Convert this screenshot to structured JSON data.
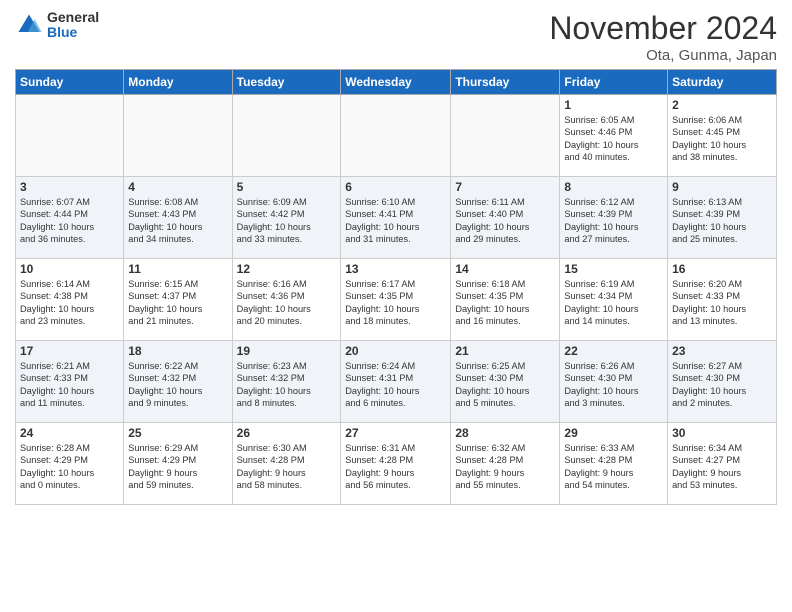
{
  "logo": {
    "general": "General",
    "blue": "Blue"
  },
  "title": "November 2024",
  "location": "Ota, Gunma, Japan",
  "days_of_week": [
    "Sunday",
    "Monday",
    "Tuesday",
    "Wednesday",
    "Thursday",
    "Friday",
    "Saturday"
  ],
  "weeks": [
    [
      {
        "day": "",
        "info": ""
      },
      {
        "day": "",
        "info": ""
      },
      {
        "day": "",
        "info": ""
      },
      {
        "day": "",
        "info": ""
      },
      {
        "day": "",
        "info": ""
      },
      {
        "day": "1",
        "info": "Sunrise: 6:05 AM\nSunset: 4:46 PM\nDaylight: 10 hours\nand 40 minutes."
      },
      {
        "day": "2",
        "info": "Sunrise: 6:06 AM\nSunset: 4:45 PM\nDaylight: 10 hours\nand 38 minutes."
      }
    ],
    [
      {
        "day": "3",
        "info": "Sunrise: 6:07 AM\nSunset: 4:44 PM\nDaylight: 10 hours\nand 36 minutes."
      },
      {
        "day": "4",
        "info": "Sunrise: 6:08 AM\nSunset: 4:43 PM\nDaylight: 10 hours\nand 34 minutes."
      },
      {
        "day": "5",
        "info": "Sunrise: 6:09 AM\nSunset: 4:42 PM\nDaylight: 10 hours\nand 33 minutes."
      },
      {
        "day": "6",
        "info": "Sunrise: 6:10 AM\nSunset: 4:41 PM\nDaylight: 10 hours\nand 31 minutes."
      },
      {
        "day": "7",
        "info": "Sunrise: 6:11 AM\nSunset: 4:40 PM\nDaylight: 10 hours\nand 29 minutes."
      },
      {
        "day": "8",
        "info": "Sunrise: 6:12 AM\nSunset: 4:39 PM\nDaylight: 10 hours\nand 27 minutes."
      },
      {
        "day": "9",
        "info": "Sunrise: 6:13 AM\nSunset: 4:39 PM\nDaylight: 10 hours\nand 25 minutes."
      }
    ],
    [
      {
        "day": "10",
        "info": "Sunrise: 6:14 AM\nSunset: 4:38 PM\nDaylight: 10 hours\nand 23 minutes."
      },
      {
        "day": "11",
        "info": "Sunrise: 6:15 AM\nSunset: 4:37 PM\nDaylight: 10 hours\nand 21 minutes."
      },
      {
        "day": "12",
        "info": "Sunrise: 6:16 AM\nSunset: 4:36 PM\nDaylight: 10 hours\nand 20 minutes."
      },
      {
        "day": "13",
        "info": "Sunrise: 6:17 AM\nSunset: 4:35 PM\nDaylight: 10 hours\nand 18 minutes."
      },
      {
        "day": "14",
        "info": "Sunrise: 6:18 AM\nSunset: 4:35 PM\nDaylight: 10 hours\nand 16 minutes."
      },
      {
        "day": "15",
        "info": "Sunrise: 6:19 AM\nSunset: 4:34 PM\nDaylight: 10 hours\nand 14 minutes."
      },
      {
        "day": "16",
        "info": "Sunrise: 6:20 AM\nSunset: 4:33 PM\nDaylight: 10 hours\nand 13 minutes."
      }
    ],
    [
      {
        "day": "17",
        "info": "Sunrise: 6:21 AM\nSunset: 4:33 PM\nDaylight: 10 hours\nand 11 minutes."
      },
      {
        "day": "18",
        "info": "Sunrise: 6:22 AM\nSunset: 4:32 PM\nDaylight: 10 hours\nand 9 minutes."
      },
      {
        "day": "19",
        "info": "Sunrise: 6:23 AM\nSunset: 4:32 PM\nDaylight: 10 hours\nand 8 minutes."
      },
      {
        "day": "20",
        "info": "Sunrise: 6:24 AM\nSunset: 4:31 PM\nDaylight: 10 hours\nand 6 minutes."
      },
      {
        "day": "21",
        "info": "Sunrise: 6:25 AM\nSunset: 4:30 PM\nDaylight: 10 hours\nand 5 minutes."
      },
      {
        "day": "22",
        "info": "Sunrise: 6:26 AM\nSunset: 4:30 PM\nDaylight: 10 hours\nand 3 minutes."
      },
      {
        "day": "23",
        "info": "Sunrise: 6:27 AM\nSunset: 4:30 PM\nDaylight: 10 hours\nand 2 minutes."
      }
    ],
    [
      {
        "day": "24",
        "info": "Sunrise: 6:28 AM\nSunset: 4:29 PM\nDaylight: 10 hours\nand 0 minutes."
      },
      {
        "day": "25",
        "info": "Sunrise: 6:29 AM\nSunset: 4:29 PM\nDaylight: 9 hours\nand 59 minutes."
      },
      {
        "day": "26",
        "info": "Sunrise: 6:30 AM\nSunset: 4:28 PM\nDaylight: 9 hours\nand 58 minutes."
      },
      {
        "day": "27",
        "info": "Sunrise: 6:31 AM\nSunset: 4:28 PM\nDaylight: 9 hours\nand 56 minutes."
      },
      {
        "day": "28",
        "info": "Sunrise: 6:32 AM\nSunset: 4:28 PM\nDaylight: 9 hours\nand 55 minutes."
      },
      {
        "day": "29",
        "info": "Sunrise: 6:33 AM\nSunset: 4:28 PM\nDaylight: 9 hours\nand 54 minutes."
      },
      {
        "day": "30",
        "info": "Sunrise: 6:34 AM\nSunset: 4:27 PM\nDaylight: 9 hours\nand 53 minutes."
      }
    ]
  ]
}
